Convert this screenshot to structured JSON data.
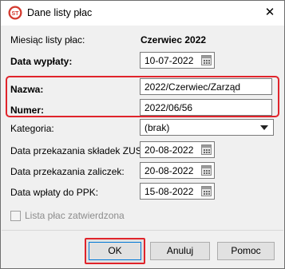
{
  "window": {
    "title": "Dane listy płac",
    "close_glyph": "✕",
    "icon": "payroll-app-icon"
  },
  "form": {
    "month": {
      "label": "Miesiąc listy płac:",
      "value": "Czerwiec 2022"
    },
    "payout_date": {
      "label": "Data wypłaty:",
      "value": "10-07-2022"
    },
    "name": {
      "label": "Nazwa:",
      "value": "2022/Czerwiec/Zarząd"
    },
    "number": {
      "label": "Numer:",
      "value": "2022/06/56"
    },
    "category": {
      "label": "Kategoria:",
      "value": "(brak)"
    },
    "zus_date": {
      "label": "Data przekazania składek ZUS:",
      "value": "20-08-2022"
    },
    "advance_date": {
      "label": "Data przekazania zaliczek:",
      "value": "20-08-2022"
    },
    "ppk_date": {
      "label": "Data wpłaty do PPK:",
      "value": "15-08-2022"
    },
    "approved": {
      "label": "Lista płac zatwierdzona",
      "checked": false,
      "enabled": false
    }
  },
  "buttons": {
    "ok": "OK",
    "cancel": "Anuluj",
    "help": "Pomoc"
  },
  "colors": {
    "highlight": "#e0242b",
    "dialog_bg": "#f0f0f0",
    "focus_border": "#0078d7"
  }
}
